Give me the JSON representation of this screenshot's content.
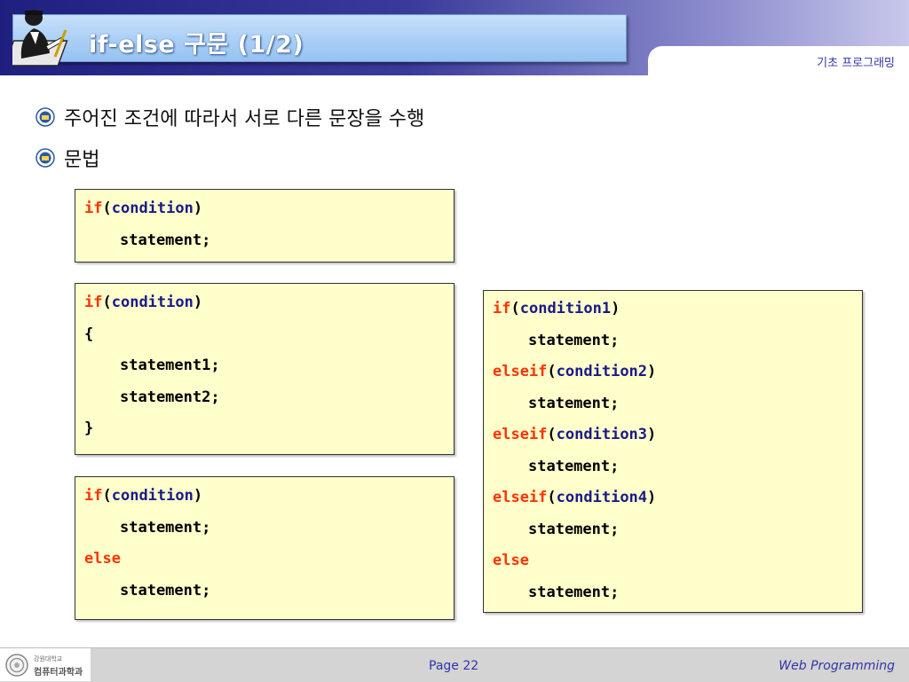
{
  "header": {
    "title": "if-else 구문 (1/2)",
    "course": "기초 프로그래밍",
    "icon": "person-writing-icon"
  },
  "bullets": [
    "주어진 조건에 따라서 서로 다른 문장을 수행",
    "문법"
  ],
  "code_boxes": {
    "if_simple": {
      "kw_if": "if",
      "open": "(",
      "cond": "condition",
      "close": ")",
      "stmt": "statement;"
    },
    "if_block": {
      "kw_if": "if",
      "open": "(",
      "cond": "condition",
      "close": ")",
      "brace_open": "{",
      "stmt1": "statement1;",
      "stmt2": "statement2;",
      "brace_close": "}"
    },
    "if_else": {
      "kw_if": "if",
      "open": "(",
      "cond": "condition",
      "close": ")",
      "stmt1": "statement;",
      "kw_else": "else",
      "stmt2": "statement;"
    },
    "elseif_chain": {
      "kw_if": "if",
      "cond1": "condition1",
      "kw_elseif": "elseif",
      "cond2": "condition2",
      "cond3": "condition3",
      "cond4": "condition4",
      "open": "(",
      "close": ")",
      "stmt": "statement;",
      "kw_else": "else"
    }
  },
  "footer": {
    "logo_line1": "강원대학교",
    "logo_line2": "컴퓨터과학과",
    "page": "Page 22",
    "course": "Web Programming"
  },
  "colors": {
    "keyword": "#ff3300",
    "condition": "#1a1a8a",
    "code_bg": "#ffffcc",
    "accent_text": "#3333aa"
  }
}
